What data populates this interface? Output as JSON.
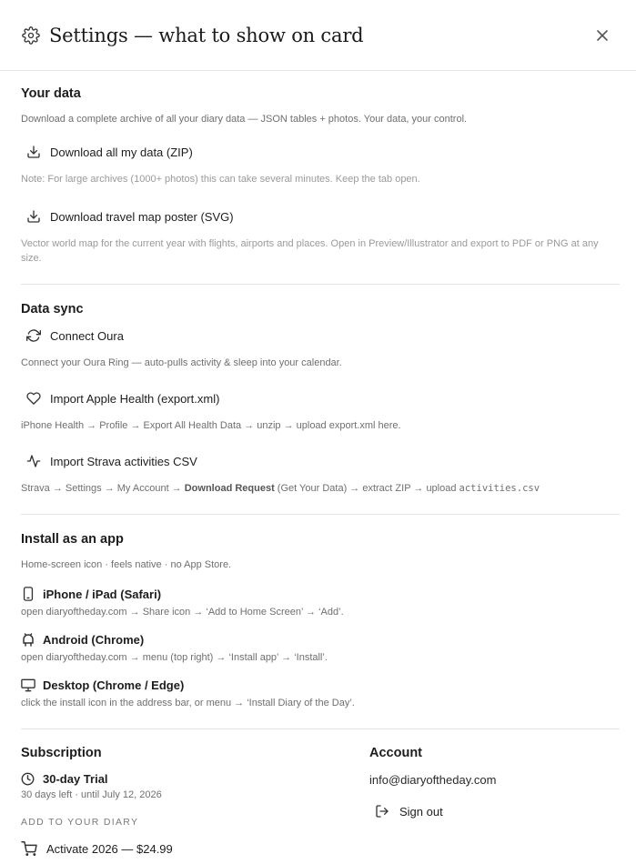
{
  "header": {
    "title": "Settings — what to show on card",
    "close_icon": "close-icon",
    "gear_icon": "gear-icon"
  },
  "your_data": {
    "title": "Your data",
    "description": "Download a complete archive of all your diary data — JSON tables + photos. Your data, your control.",
    "zip_button": "Download all my data (ZIP)",
    "zip_note": "Note: For large archives (1000+ photos) this can take several minutes. Keep the tab open.",
    "poster_button": "Download travel map poster (SVG)",
    "poster_note": "Vector world map for the current year with flights, airports and places. Open in Preview/Illustrator and export to PDF or PNG at any size."
  },
  "data_sync": {
    "title": "Data sync",
    "oura_button": "Connect Oura",
    "oura_desc": "Connect your Oura Ring — auto-pulls activity & sleep into your calendar.",
    "apple_button": "Import Apple Health (export.xml)",
    "apple_desc": "iPhone Health → Profile → Export All Health Data → unzip → upload export.xml here.",
    "strava_button": "Import Strava activities CSV",
    "strava_desc_1": "Strava → Settings → My Account → ",
    "strava_desc_bold": "Download Request",
    "strava_desc_2": " (Get Your Data) → extract ZIP → upload ",
    "strava_desc_code": "activities.csv"
  },
  "install": {
    "title": "Install as an app",
    "subtitle": "Home-screen icon · feels native · no App Store.",
    "iphone_label": "iPhone / iPad (Safari)",
    "iphone_desc": "open diaryoftheday.com → Share icon → ‘Add to Home Screen’ → ‘Add’.",
    "android_label": "Android (Chrome)",
    "android_desc": "open diaryoftheday.com → menu (top right) → ‘Install app’ → ‘Install’.",
    "desktop_label": "Desktop (Chrome / Edge)",
    "desktop_desc": "click the install icon in the address bar, or menu → ‘Install Diary of the Day’."
  },
  "subscription": {
    "title": "Subscription",
    "plan": "30-day Trial",
    "remaining": "30 days left · until July 12, 2026",
    "add_caps": "ADD TO YOUR DIARY",
    "activate_button": "Activate 2026 — $24.99"
  },
  "account": {
    "title": "Account",
    "email": "info@diaryoftheday.com",
    "signout_button": "Sign out"
  }
}
